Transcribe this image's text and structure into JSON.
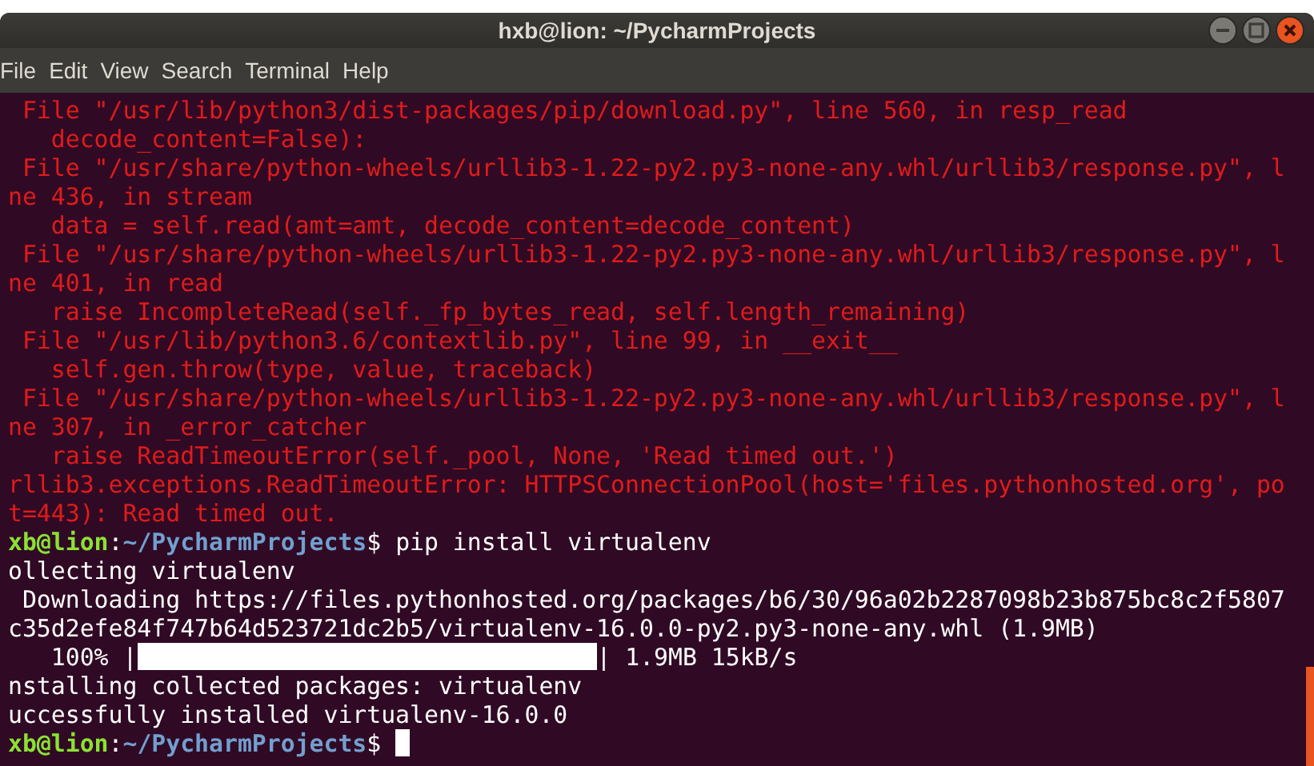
{
  "window": {
    "title": "hxb@lion: ~/PycharmProjects"
  },
  "menu": [
    "File",
    "Edit",
    "View",
    "Search",
    "Terminal",
    "Help"
  ],
  "lines": [
    {
      "kind": "error",
      "text": " File \"/usr/lib/python3/dist-packages/pip/download.py\", line 560, in resp_read"
    },
    {
      "kind": "error",
      "text": "   decode_content=False):"
    },
    {
      "kind": "error",
      "text": " File \"/usr/share/python-wheels/urllib3-1.22-py2.py3-none-any.whl/urllib3/response.py\", l"
    },
    {
      "kind": "error",
      "text": "ne 436, in stream"
    },
    {
      "kind": "error",
      "text": "   data = self.read(amt=amt, decode_content=decode_content)"
    },
    {
      "kind": "error",
      "text": " File \"/usr/share/python-wheels/urllib3-1.22-py2.py3-none-any.whl/urllib3/response.py\", l"
    },
    {
      "kind": "error",
      "text": "ne 401, in read"
    },
    {
      "kind": "error",
      "text": "   raise IncompleteRead(self._fp_bytes_read, self.length_remaining)"
    },
    {
      "kind": "error",
      "text": " File \"/usr/lib/python3.6/contextlib.py\", line 99, in __exit__"
    },
    {
      "kind": "error",
      "text": "   self.gen.throw(type, value, traceback)"
    },
    {
      "kind": "error",
      "text": " File \"/usr/share/python-wheels/urllib3-1.22-py2.py3-none-any.whl/urllib3/response.py\", l"
    },
    {
      "kind": "error",
      "text": "ne 307, in _error_catcher"
    },
    {
      "kind": "error",
      "text": "   raise ReadTimeoutError(self._pool, None, 'Read timed out.')"
    },
    {
      "kind": "error",
      "text": "rllib3.exceptions.ReadTimeoutError: HTTPSConnectionPool(host='files.pythonhosted.org', po"
    },
    {
      "kind": "error",
      "text": "t=443): Read timed out."
    },
    {
      "kind": "prompt",
      "user": "xb@lion",
      "separator": ":",
      "path": "~/PycharmProjects",
      "dollar": "$",
      "command": "pip install virtualenv",
      "cursor": false
    },
    {
      "kind": "output",
      "text": "ollecting virtualenv"
    },
    {
      "kind": "output",
      "text": " Downloading https://files.pythonhosted.org/packages/b6/30/96a02b2287098b23b875bc8c2f5807"
    },
    {
      "kind": "output",
      "text": "c35d2efe84f747b64d523721dc2b5/virtualenv-16.0.0-py2.py3-none-any.whl (1.9MB)"
    },
    {
      "kind": "progress",
      "prefix": "   100% |",
      "level": 1,
      "suffix": "| 1.9MB 15kB/s"
    },
    {
      "kind": "output",
      "text": "nstalling collected packages: virtualenv"
    },
    {
      "kind": "output",
      "text": "uccessfully installed virtualenv-16.0.0"
    },
    {
      "kind": "prompt",
      "user": "xb@lion",
      "separator": ":",
      "path": "~/PycharmProjects",
      "dollar": "$",
      "cursor": true
    }
  ]
}
